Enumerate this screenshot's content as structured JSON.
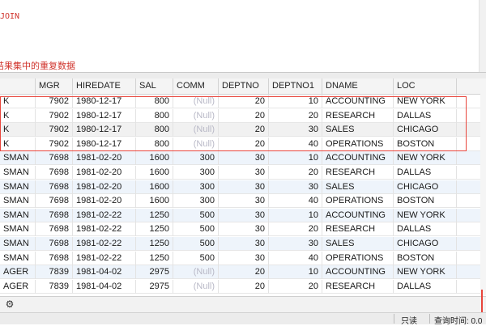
{
  "editor": {
    "line1": "JOIN",
    "line2": "结果集中的重复数据"
  },
  "grid": {
    "columns": [
      "MGR",
      "HIREDATE",
      "SAL",
      "COMM",
      "DEPTNO",
      "DEPTNO1",
      "DNAME",
      "LOC"
    ],
    "rows": [
      {
        "job": "K",
        "mgr": "7902",
        "hiredate": "1980-12-17",
        "sal": "800",
        "comm": "(Null)",
        "deptno": "20",
        "deptno1": "10",
        "dname": "ACCOUNTING",
        "loc": "NEW YORK"
      },
      {
        "job": "K",
        "mgr": "7902",
        "hiredate": "1980-12-17",
        "sal": "800",
        "comm": "(Null)",
        "deptno": "20",
        "deptno1": "20",
        "dname": "RESEARCH",
        "loc": "DALLAS"
      },
      {
        "job": "K",
        "mgr": "7902",
        "hiredate": "1980-12-17",
        "sal": "800",
        "comm": "(Null)",
        "deptno": "20",
        "deptno1": "30",
        "dname": "SALES",
        "loc": "CHICAGO"
      },
      {
        "job": "K",
        "mgr": "7902",
        "hiredate": "1980-12-17",
        "sal": "800",
        "comm": "(Null)",
        "deptno": "20",
        "deptno1": "40",
        "dname": "OPERATIONS",
        "loc": "BOSTON"
      },
      {
        "job": "SMAN",
        "mgr": "7698",
        "hiredate": "1981-02-20",
        "sal": "1600",
        "comm": "300",
        "deptno": "30",
        "deptno1": "10",
        "dname": "ACCOUNTING",
        "loc": "NEW YORK"
      },
      {
        "job": "SMAN",
        "mgr": "7698",
        "hiredate": "1981-02-20",
        "sal": "1600",
        "comm": "300",
        "deptno": "30",
        "deptno1": "20",
        "dname": "RESEARCH",
        "loc": "DALLAS"
      },
      {
        "job": "SMAN",
        "mgr": "7698",
        "hiredate": "1981-02-20",
        "sal": "1600",
        "comm": "300",
        "deptno": "30",
        "deptno1": "30",
        "dname": "SALES",
        "loc": "CHICAGO"
      },
      {
        "job": "SMAN",
        "mgr": "7698",
        "hiredate": "1981-02-20",
        "sal": "1600",
        "comm": "300",
        "deptno": "30",
        "deptno1": "40",
        "dname": "OPERATIONS",
        "loc": "BOSTON"
      },
      {
        "job": "SMAN",
        "mgr": "7698",
        "hiredate": "1981-02-22",
        "sal": "1250",
        "comm": "500",
        "deptno": "30",
        "deptno1": "10",
        "dname": "ACCOUNTING",
        "loc": "NEW YORK"
      },
      {
        "job": "SMAN",
        "mgr": "7698",
        "hiredate": "1981-02-22",
        "sal": "1250",
        "comm": "500",
        "deptno": "30",
        "deptno1": "20",
        "dname": "RESEARCH",
        "loc": "DALLAS"
      },
      {
        "job": "SMAN",
        "mgr": "7698",
        "hiredate": "1981-02-22",
        "sal": "1250",
        "comm": "500",
        "deptno": "30",
        "deptno1": "30",
        "dname": "SALES",
        "loc": "CHICAGO"
      },
      {
        "job": "SMAN",
        "mgr": "7698",
        "hiredate": "1981-02-22",
        "sal": "1250",
        "comm": "500",
        "deptno": "30",
        "deptno1": "40",
        "dname": "OPERATIONS",
        "loc": "BOSTON"
      },
      {
        "job": "AGER",
        "mgr": "7839",
        "hiredate": "1981-04-02",
        "sal": "2975",
        "comm": "(Null)",
        "deptno": "20",
        "deptno1": "10",
        "dname": "ACCOUNTING",
        "loc": "NEW YORK"
      },
      {
        "job": "AGER",
        "mgr": "7839",
        "hiredate": "1981-04-02",
        "sal": "2975",
        "comm": "(Null)",
        "deptno": "20",
        "deptno1": "20",
        "dname": "RESEARCH",
        "loc": "DALLAS"
      }
    ]
  },
  "bottom_bar": {
    "settings_icon": "gear-icon"
  },
  "status": {
    "readonly": "只读",
    "query_time": "查询时间: 0.0"
  },
  "colors": {
    "highlight": "#e8453c",
    "alt_row": "#eef4fb",
    "null_text": "#b9b9c7",
    "sql_keyword": "#d0342c"
  }
}
